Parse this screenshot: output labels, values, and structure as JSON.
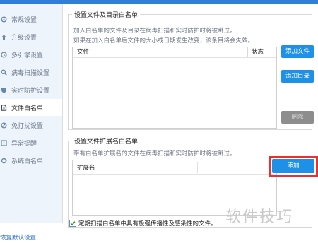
{
  "window": {
    "title": ""
  },
  "sidebar": {
    "items": [
      {
        "label": "常规设置",
        "icon": "gear-icon"
      },
      {
        "label": "升级设置",
        "icon": "upgrade-icon"
      },
      {
        "label": "多引擎设置",
        "icon": "engine-icon"
      },
      {
        "label": "病毒扫描设置",
        "icon": "scan-icon"
      },
      {
        "label": "实时防护设置",
        "icon": "shield-icon"
      },
      {
        "label": "文件白名单",
        "icon": "file-icon"
      },
      {
        "label": "免打扰设置",
        "icon": "dnd-icon"
      },
      {
        "label": "异常提醒",
        "icon": "alert-icon"
      },
      {
        "label": "系统白名单",
        "icon": "system-icon"
      }
    ],
    "active_index": 5,
    "restore_default_label": "恢复默认设置"
  },
  "file_whitelist": {
    "title": "设置文件及目录白名单",
    "desc_line1": "加入白名单的文件及目录在病毒扫描和实时防护时将被跳过。",
    "desc_line2": "如果在加入白名单后文件的大小或日期发生改变，该条目将会失效。",
    "col_file": "文件",
    "col_status": "状态",
    "btn_add_file": "添加文件",
    "btn_add_dir": "添加目录",
    "btn_delete": "删除"
  },
  "ext_whitelist": {
    "title": "设置文件扩展名白名单",
    "desc": "带有白名单扩展名的文件在病毒扫描和实时防护时将被跳过。",
    "col_ext": "扩展名",
    "btn_add": "添加"
  },
  "option": {
    "checked": true,
    "label": "定期扫描白名单中具有极强传播性及感染性的文件。"
  },
  "watermark": "软件技巧",
  "colors": {
    "accent": "#1e90e8",
    "highlight": "#e63232",
    "disabled": "#8d8d8d"
  }
}
